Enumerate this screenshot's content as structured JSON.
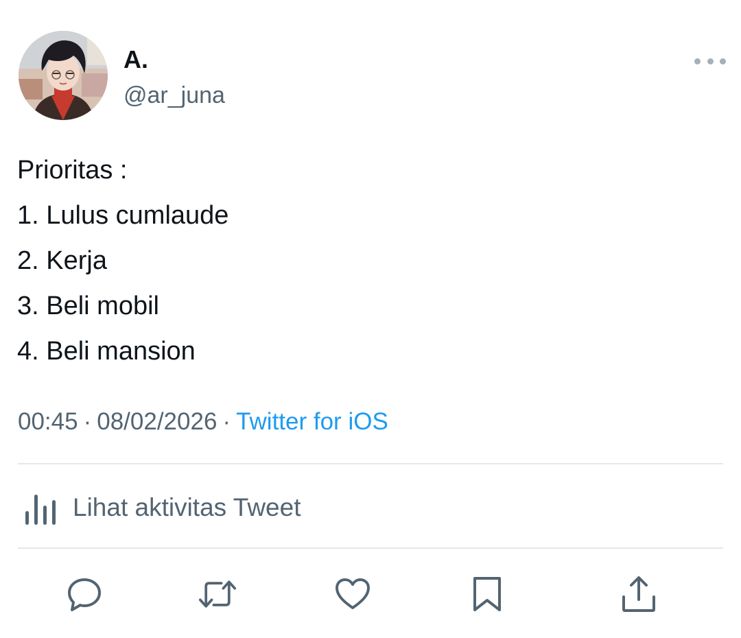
{
  "author": {
    "display_name": "A.",
    "handle": "@ar_juna"
  },
  "tweet": {
    "lines": [
      "Prioritas :",
      "1. Lulus cumlaude",
      "2. Kerja",
      "3. Beli mobil",
      "4. Beli mansion"
    ],
    "time": "00:45",
    "separator": "·",
    "date": "08/02/2026",
    "source": "Twitter for iOS"
  },
  "activity": {
    "label": "Lihat aktivitas Tweet",
    "icon": "bar-chart-icon"
  },
  "actions": [
    {
      "icon": "reply-icon"
    },
    {
      "icon": "retweet-icon"
    },
    {
      "icon": "like-icon"
    },
    {
      "icon": "bookmark-icon"
    },
    {
      "icon": "share-icon"
    }
  ],
  "colors": {
    "text_primary": "#0f1419",
    "text_secondary": "#536471",
    "link": "#1d9bf0",
    "divider": "#e4e8eb",
    "icon": "#536471"
  }
}
